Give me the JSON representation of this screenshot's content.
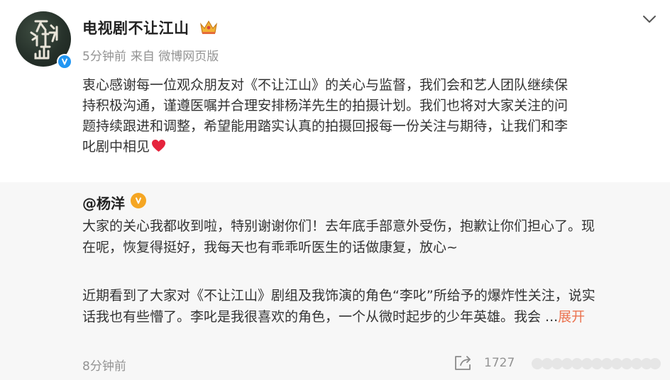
{
  "author": {
    "name": "电视剧不让江山",
    "avatar_text": "不让江山",
    "badge_icon": "crown-icon",
    "verified_icon": "verified-icon",
    "colors": {
      "verified": "#2196f3",
      "avatar_bg": "#26312a"
    }
  },
  "meta": {
    "time": "5分钟前",
    "source": "来自 微博网页版"
  },
  "post": {
    "lines": [
      "衷心感谢每一位观众朋友对《不让江山》的关心与监督，我们会和艺人团队继续保",
      "持积极沟通，谨遵医嘱并合理安排杨洋先生的拍摄计划。我们也将对大家关注的问",
      "题持续跟进和调整，希望能用踏实认真的拍摄回报每一份关注与期待，让我们和李",
      "叱剧中相见"
    ],
    "emoji": "heart-icon"
  },
  "repost": {
    "author": "@杨洋",
    "badge_icon": "orange-verified-icon",
    "paragraph1": [
      "大家的关心我都收到啦，特别谢谢你们！去年底手部意外受伤，抱歉让你们担心了。现",
      "在呢，恢复得挺好，我每天也有乖乖听医生的话做康复，放心~"
    ],
    "paragraph2": [
      "近期看到了大家对《不让江山》剧组及我饰演的角色“李叱”所给予的爆炸性关注，说实",
      "话我也有些懵了。李叱是我很喜欢的角色，一个从微时起步的少年英雄。我会 ..."
    ],
    "expand_label": "展开",
    "time": "8分钟前",
    "share_count": "1727",
    "colors": {
      "background": "#f7f7f7",
      "expand": "#eb7350",
      "badge": "#f5a623"
    }
  }
}
